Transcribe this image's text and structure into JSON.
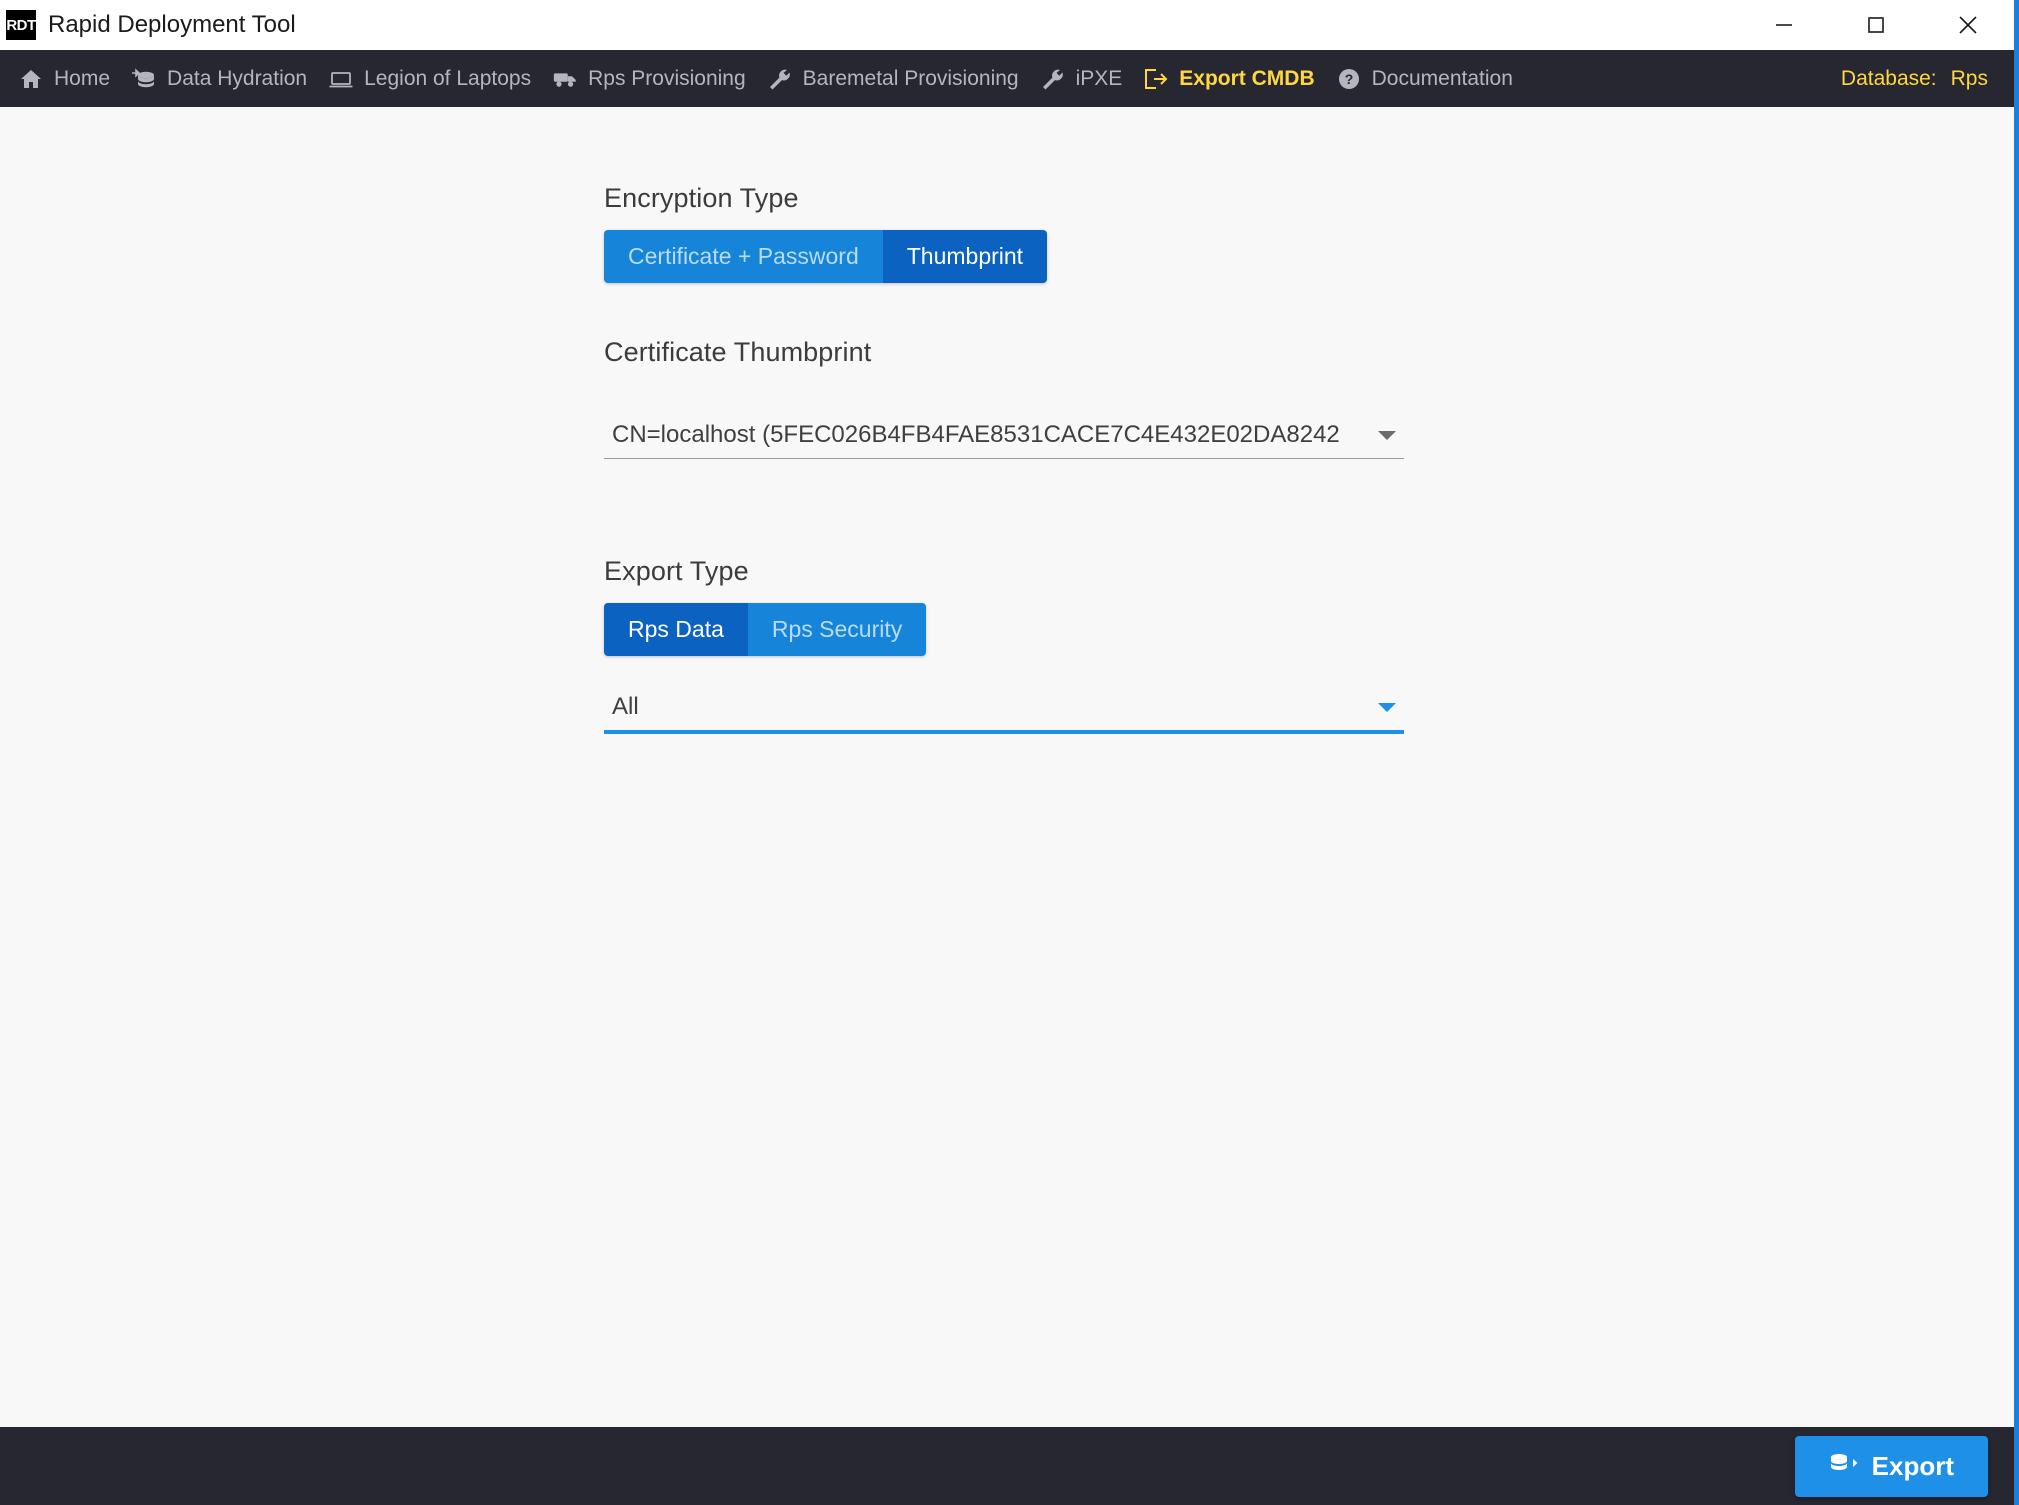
{
  "window": {
    "logo_text": "RDT",
    "title": "Rapid Deployment Tool",
    "minimize_label": "Minimize",
    "maximize_label": "Maximize",
    "close_label": "Close",
    "accent_color": "#1d7fd8"
  },
  "nav": {
    "items": [
      {
        "label": "Home",
        "icon": "home-icon",
        "active": false
      },
      {
        "label": "Data Hydration",
        "icon": "database-arrow-icon",
        "active": false
      },
      {
        "label": "Legion of Laptops",
        "icon": "laptop-icon",
        "active": false
      },
      {
        "label": "Rps Provisioning",
        "icon": "truck-icon",
        "active": false
      },
      {
        "label": "Baremetal Provisioning",
        "icon": "wrench-icon",
        "active": false
      },
      {
        "label": "iPXE",
        "icon": "wrench-icon",
        "active": false
      },
      {
        "label": "Export CMDB",
        "icon": "export-box-icon",
        "active": true
      },
      {
        "label": "Documentation",
        "icon": "question-circle-icon",
        "active": false
      }
    ],
    "database_label": "Database:",
    "database_value": "Rps",
    "bar_color": "#272732",
    "active_color": "#ffd740",
    "inactive_color": "#b5b5bd"
  },
  "main": {
    "encryption_type": {
      "label": "Encryption Type",
      "options": [
        {
          "label": "Certificate + Password",
          "selected": false
        },
        {
          "label": "Thumbprint",
          "selected": true
        }
      ]
    },
    "certificate_thumbprint": {
      "label": "Certificate Thumbprint",
      "value": "CN=localhost (5FEC026B4FB4FAE8531CACE7C4E432E02DA8242",
      "focused": false
    },
    "export_type": {
      "label": "Export Type",
      "options": [
        {
          "label": "Rps Data",
          "selected": true
        },
        {
          "label": "Rps Security",
          "selected": false
        }
      ]
    },
    "export_scope": {
      "value": "All",
      "focused": true
    },
    "selected_color": "#0b62c1",
    "unselected_color": "#1684d8"
  },
  "footer": {
    "export_label": "Export",
    "export_icon": "database-export-icon",
    "button_color": "#1f90e8",
    "bar_color": "#272732"
  }
}
